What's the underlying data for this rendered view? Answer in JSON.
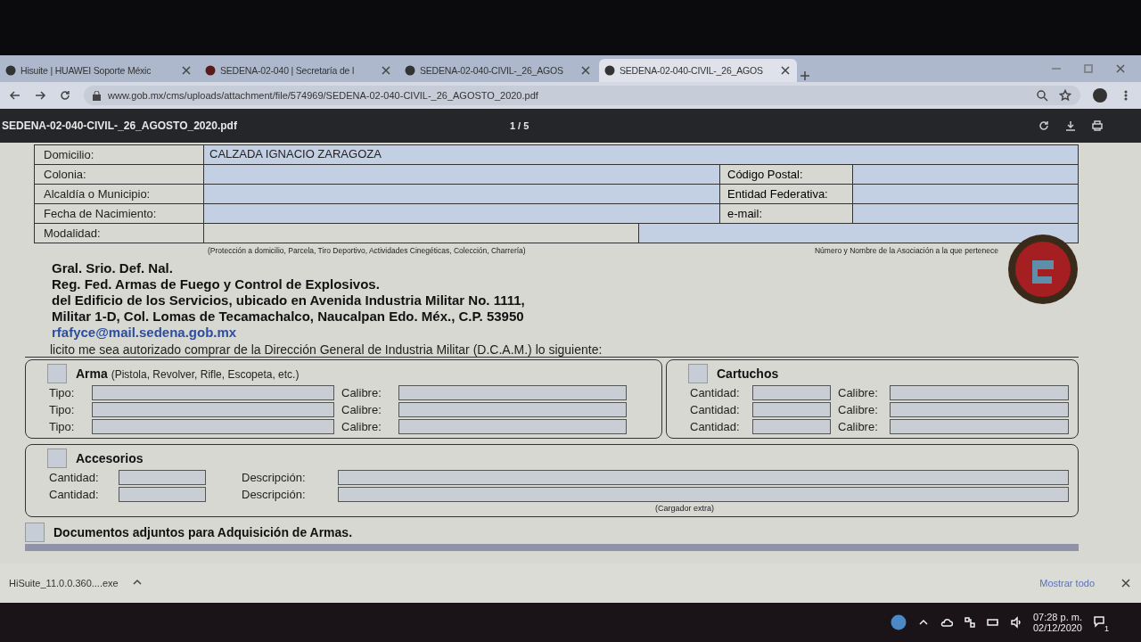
{
  "browser": {
    "tabs": [
      {
        "title": "Hisuite | HUAWEI Soporte Méxic",
        "selected": false
      },
      {
        "title": "SEDENA-02-040 | Secretaría de l",
        "selected": false
      },
      {
        "title": "SEDENA-02-040-CIVIL-_26_AGOS",
        "selected": false
      },
      {
        "title": "SEDENA-02-040-CIVIL-_26_AGOS",
        "selected": true
      }
    ],
    "url": "www.gob.mx/cms/uploads/attachment/file/574969/SEDENA-02-040-CIVIL-_26_AGOSTO_2020.pdf"
  },
  "pdf_toolbar": {
    "title": "SEDENA-02-040-CIVIL-_26_AGOSTO_2020.pdf",
    "page": "1 / 5"
  },
  "form": {
    "personal_rows": [
      {
        "label": "Domicilio:",
        "value": "CALZADA IGNACIO ZARAGOZA"
      },
      {
        "label": "Colonia:",
        "extra_label": "Código Postal:"
      },
      {
        "label": "Alcaldía o Municipio:",
        "extra_label": "Entidad Federativa:"
      },
      {
        "label": "Fecha de Nacimiento:",
        "extra_label": "e-mail:"
      },
      {
        "label": "Modalidad:"
      }
    ],
    "modalidad_note": "(Protección a domicilio, Parcela, Tiro Deportivo, Actividades Cinegéticas, Colección, Charrería)",
    "association_note": "Número y Nombre de la Asociación a la que pertenece",
    "address_lines": [
      "Gral. Srio. Def. Nal.",
      "Reg. Fed. Armas de Fuego y Control de Explosivos.",
      "del Edificio de los Servicios, ubicado en Avenida Industria Militar No. 1111,",
      "Militar 1-D, Col. Lomas de Tecamachalco, Naucalpan Edo. Méx., C.P. 53950"
    ],
    "email": "rfafyce@mail.sedena.gob.mx",
    "request": "licito me sea autorizado comprar de la Dirección General de Industria Militar (D.C.A.M.) lo siguiente:",
    "arma": {
      "checked": false,
      "title": "Arma",
      "hint": "(Pistola, Revolver, Rifle, Escopeta, etc.)",
      "rows": [
        {
          "label": "Tipo:",
          "label2": "Calibre:"
        },
        {
          "label": "Tipo:",
          "label2": "Calibre:"
        },
        {
          "label": "Tipo:",
          "label2": "Calibre:"
        }
      ]
    },
    "cartuchos": {
      "checked": false,
      "title": "Cartuchos",
      "rows": [
        {
          "label": "Cantidad:",
          "label2": "Calibre:"
        },
        {
          "label": "Cantidad:",
          "label2": "Calibre:"
        },
        {
          "label": "Cantidad:",
          "label2": "Calibre:"
        }
      ]
    },
    "accesorios": {
      "checked": false,
      "title": "Accesorios",
      "rows": [
        {
          "label": "Cantidad:",
          "label2": "Descripción:"
        },
        {
          "label": "Cantidad:",
          "label2": "Descripción:"
        }
      ],
      "note": "(Cargador extra)"
    },
    "documentos": {
      "checked": false,
      "title": "Documentos adjuntos para Adquisición de Armas."
    }
  },
  "downloads": {
    "file": "HiSuite_11.0.0.360....exe",
    "show_all": "Mostrar todo"
  },
  "taskbar": {
    "time": "07:28 p. m.",
    "date": "02/12/2020",
    "notifications": "1"
  }
}
